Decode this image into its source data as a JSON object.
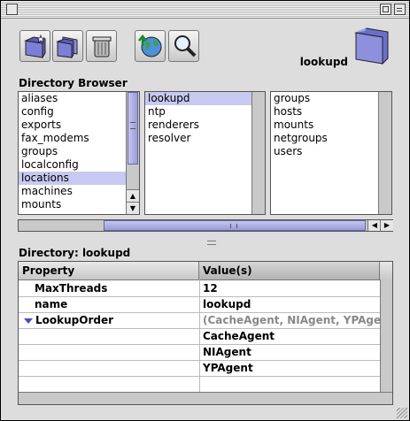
{
  "toolbar": {
    "buttons": [
      {
        "icon": "new-folder-icon"
      },
      {
        "icon": "duplicate-folder-icon"
      },
      {
        "icon": "trash-icon"
      },
      {
        "icon": "globe-upload-icon"
      },
      {
        "icon": "magnifier-icon"
      }
    ]
  },
  "current_directory": "lookupd",
  "browser": {
    "label": "Directory Browser",
    "column1": [
      "aliases",
      "config",
      "exports",
      "fax_modems",
      "groups",
      "localconfig",
      "locations",
      "machines",
      "mounts"
    ],
    "column1_selected": "locations",
    "column2": [
      "lookupd",
      "ntp",
      "renderers",
      "resolver"
    ],
    "column2_selected": "lookupd",
    "column3": [
      "groups",
      "hosts",
      "mounts",
      "netgroups",
      "users"
    ]
  },
  "directory": {
    "label": "Directory: lookupd",
    "headers": {
      "property": "Property",
      "value": "Value(s)"
    },
    "rows": [
      {
        "property": "MaxThreads",
        "value": "12"
      },
      {
        "property": "name",
        "value": "lookupd"
      },
      {
        "property": "LookupOrder",
        "value": "(CacheAgent, NIAgent, YPAgent)"
      },
      {
        "property": "",
        "value": "CacheAgent"
      },
      {
        "property": "",
        "value": "NIAgent"
      },
      {
        "property": "",
        "value": "YPAgent"
      }
    ]
  },
  "colors": {
    "selection": "#c7c9f0",
    "scroll_thumb": "#9a9cd8",
    "folder": "#7b7fd6"
  }
}
